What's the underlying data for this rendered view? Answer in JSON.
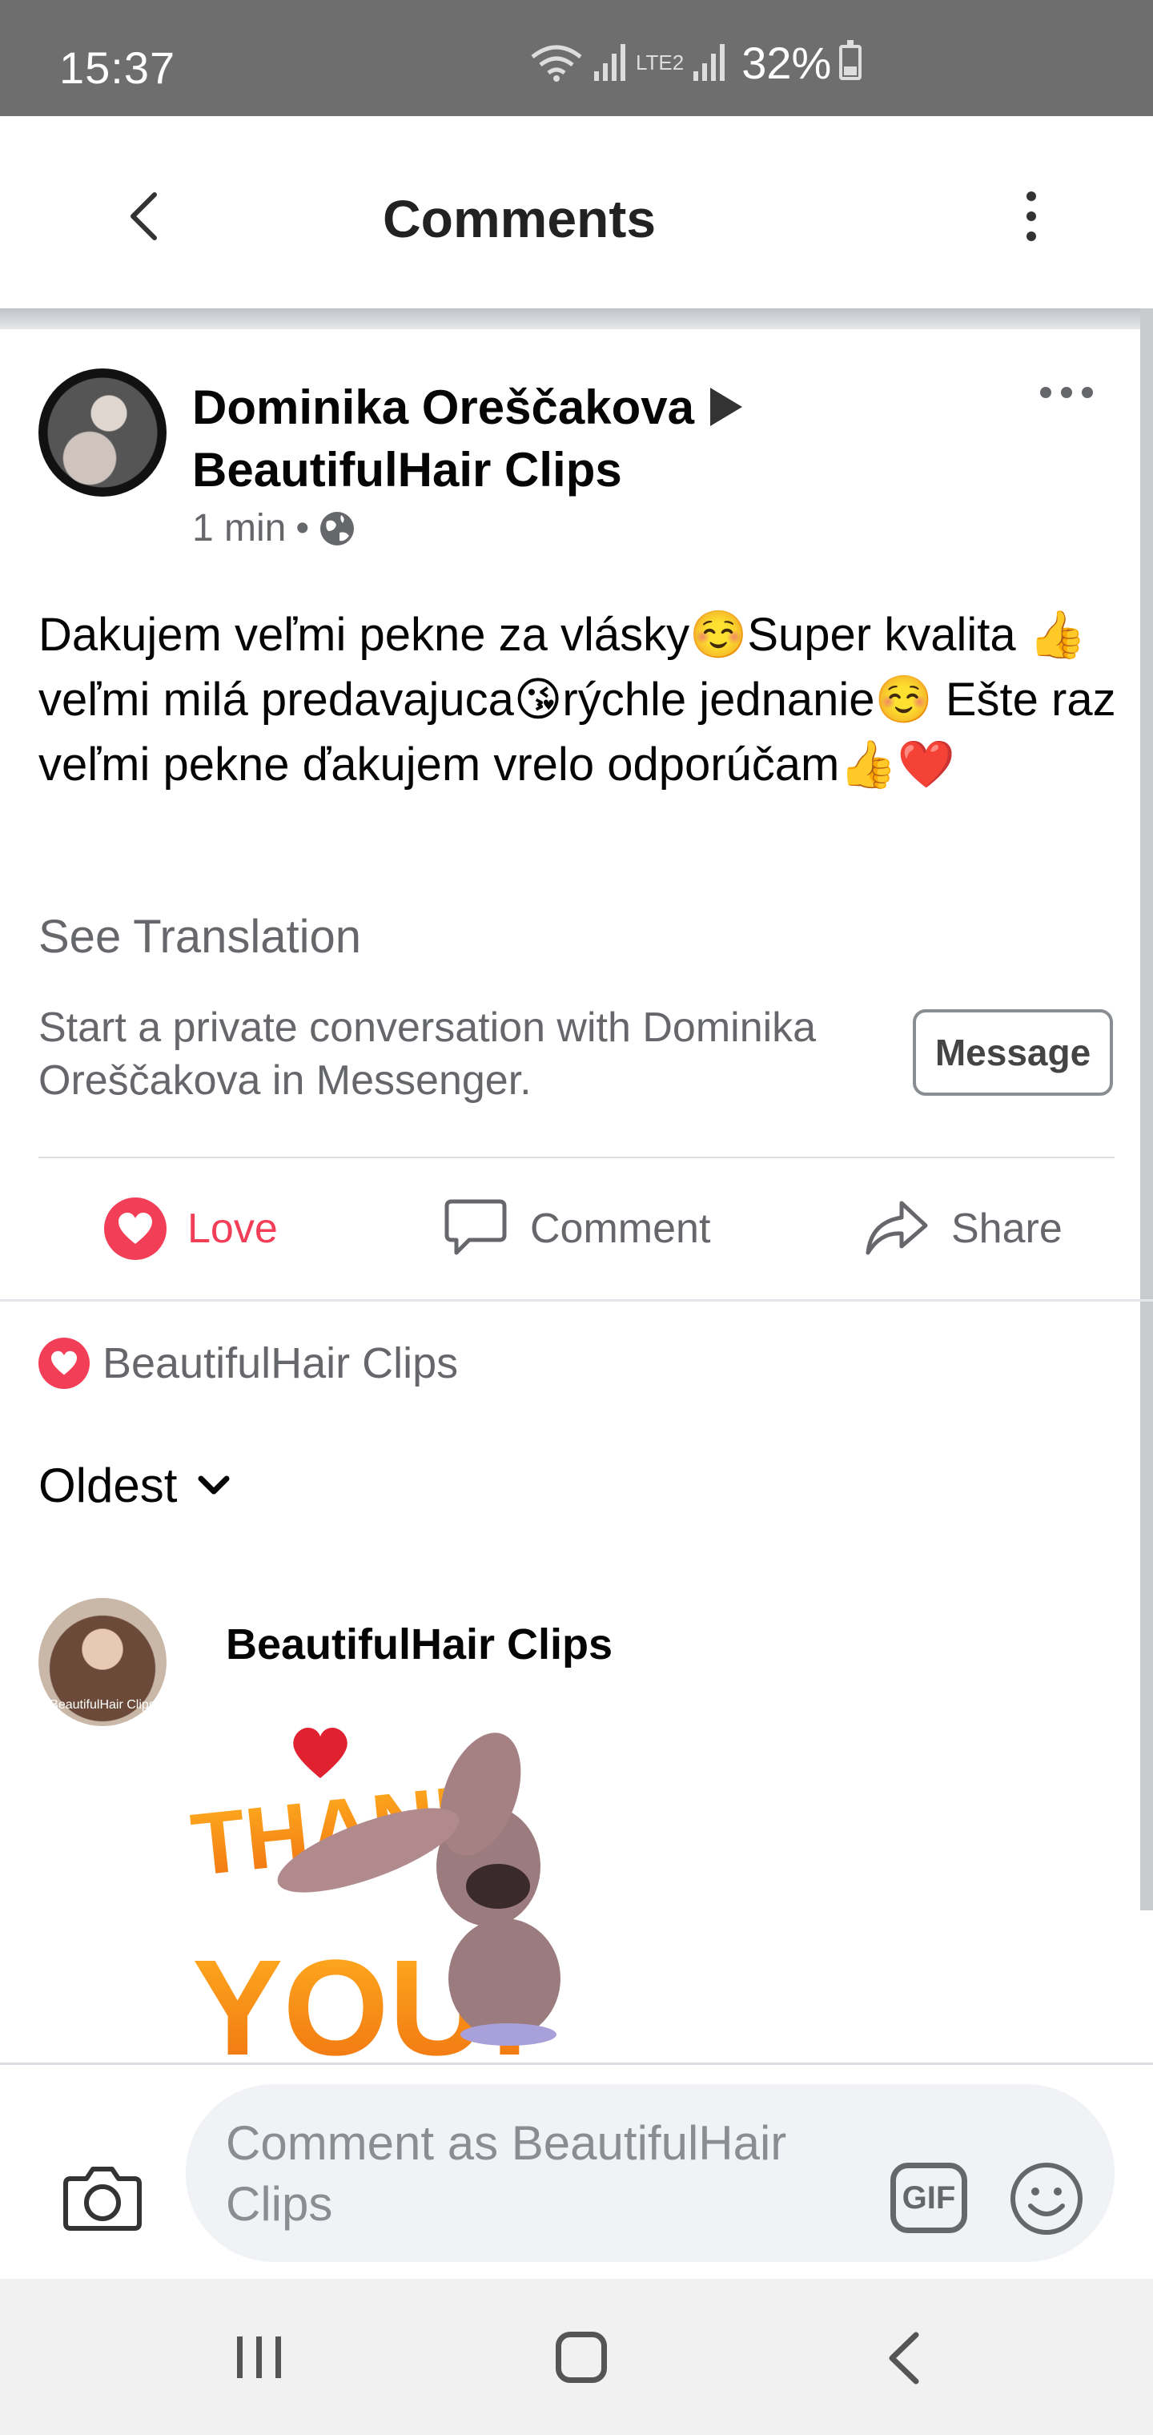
{
  "status_bar": {
    "time": "15:37",
    "network": "LTE2",
    "battery_percent": "32%"
  },
  "header": {
    "title": "Comments"
  },
  "post": {
    "author": "Dominika Oreščakova",
    "target": "BeautifulHair Clips",
    "time": "1 min",
    "visibility_icon": "globe-icon",
    "text": "Dakujem veľmi pekne za vlásky☺️Super kvalita 👍veľmi milá predavajuca😘rýchle jednanie☺️ Ešte raz veľmi pekne ďakujem vrelo odporúčam👍❤️",
    "see_translation": "See Translation",
    "messenger_prompt": "Start a private conversation with Dominika Oreščakova in Messenger.",
    "message_button": "Message"
  },
  "actions": {
    "love": "Love",
    "comment": "Comment",
    "share": "Share"
  },
  "reaction_summary": {
    "name": "BeautifulHair Clips"
  },
  "sort": {
    "label": "Oldest"
  },
  "comments": [
    {
      "author": "BeautifulHair Clips",
      "avatar_caption": "BeautifulHair Clips",
      "sticker_text_1": "THANK",
      "sticker_text_2": "YOU!"
    }
  ],
  "compose": {
    "placeholder": "Comment as BeautifulHair Clips",
    "gif_label": "GIF"
  },
  "colors": {
    "love": "#f33e58",
    "secondary_text": "#65676b",
    "status_bar": "#6e6e6e"
  }
}
